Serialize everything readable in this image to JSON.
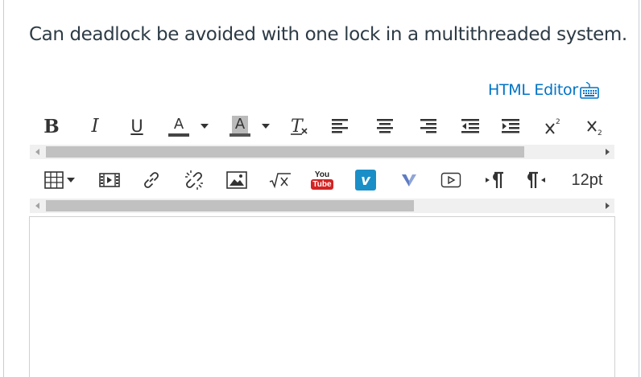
{
  "question": {
    "text": "Can deadlock be avoided with one lock in a multithreaded system."
  },
  "editor": {
    "html_editor_label": "HTML Editor",
    "toolbar1": {
      "bold": "B",
      "italic": "I",
      "underline": "U",
      "text_color": "A",
      "bg_color": "A"
    },
    "toolbar2": {
      "youtube_top": "You",
      "youtube_bottom": "Tube",
      "vimeo": "v",
      "font_size": "12pt"
    }
  },
  "colors": {
    "link": "#0073c6",
    "youtube_red": "#d32323",
    "vimeo_blue": "#1a8fc7",
    "scroll_thumb": "#c1c1c1"
  }
}
